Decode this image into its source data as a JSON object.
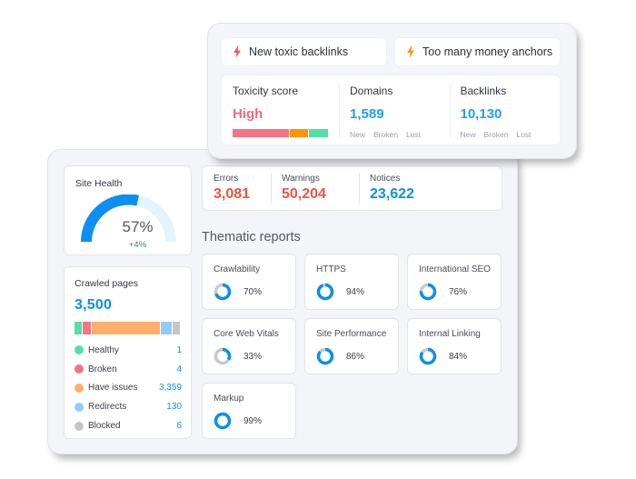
{
  "alerts": [
    {
      "label": "New toxic backlinks",
      "icon": "lightning-icon",
      "color": "#f0595f"
    },
    {
      "label": "Too many money anchors",
      "icon": "lightning-icon",
      "color": "#f79a1a"
    }
  ],
  "backlink_metrics": {
    "toxicity": {
      "label": "Toxicity score",
      "value": "High",
      "bar": [
        {
          "share": 0.6,
          "color": "#f27585"
        },
        {
          "share": 0.2,
          "color": "#ff9405"
        },
        {
          "share": 0.2,
          "color": "#55dfa7"
        }
      ]
    },
    "domains": {
      "label": "Domains",
      "value": "1,589",
      "links": [
        "New",
        "Broken",
        "Lost"
      ]
    },
    "backlinks": {
      "label": "Backlinks",
      "value": "10,130",
      "links": [
        "New",
        "Broken",
        "Lost"
      ]
    }
  },
  "site_health": {
    "label": "Site Health",
    "value": "57%",
    "percent": 57,
    "delta": "+4%",
    "fill_color": "#0b8ff0",
    "track_color": "#e4f4fd"
  },
  "crawled_pages": {
    "label": "Crawled pages",
    "total": "3,500",
    "items": [
      {
        "label": "Healthy",
        "count": "1",
        "color": "#55dfa7",
        "bar_weight": 0.07
      },
      {
        "label": "Broken",
        "count": "4",
        "color": "#f27585",
        "bar_weight": 0.08
      },
      {
        "label": "Have issues",
        "count": "3,359",
        "color": "#ffae6b",
        "bar_weight": 0.66
      },
      {
        "label": "Redirects",
        "count": "130",
        "color": "#8fcbfb",
        "bar_weight": 0.1
      },
      {
        "label": "Blocked",
        "count": "6",
        "color": "#c4c6cc",
        "bar_weight": 0.07
      }
    ]
  },
  "issues": [
    {
      "label": "Errors",
      "value": "3,081",
      "tone": "red"
    },
    {
      "label": "Warnings",
      "value": "50,204",
      "tone": "red"
    },
    {
      "label": "Notices",
      "value": "23,622",
      "tone": "blue"
    }
  ],
  "thematic": {
    "title": "Thematic reports",
    "reports": [
      {
        "label": "Crawlability",
        "value": "70%",
        "percent": 70
      },
      {
        "label": "HTTPS",
        "value": "94%",
        "percent": 94
      },
      {
        "label": "International SEO",
        "value": "76%",
        "percent": 76
      },
      {
        "label": "Core Web Vitals",
        "value": "33%",
        "percent": 33
      },
      {
        "label": "Site Performance",
        "value": "86%",
        "percent": 86
      },
      {
        "label": "Internal Linking",
        "value": "84%",
        "percent": 84
      },
      {
        "label": "Markup",
        "value": "99%",
        "percent": 99
      }
    ]
  }
}
